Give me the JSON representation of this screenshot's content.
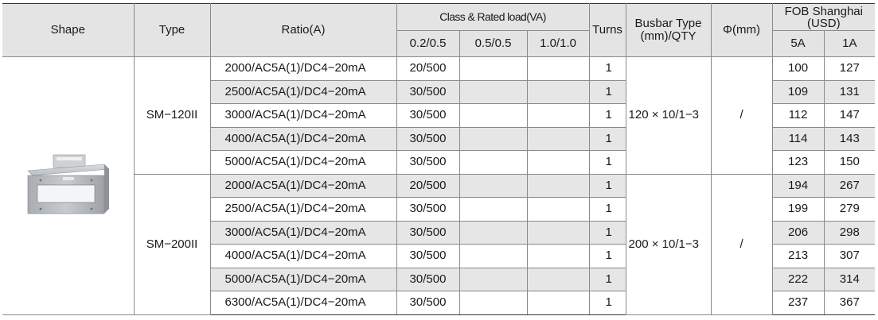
{
  "header": {
    "shape": "Shape",
    "type": "Type",
    "ratio": "Ratio(A)",
    "class_rated_load": "Class & Rated load(VA)",
    "class_02_05": "0.2/0.5",
    "class_05_05": "0.5/0.5",
    "class_10_10": "1.0/1.0",
    "turns": "Turns",
    "busbar": "Busbar Type (mm)/QTY",
    "phi": "Φ(mm)",
    "fob": "FOB Shanghai (USD)",
    "price_5a": "5A",
    "price_1a": "1A"
  },
  "groups": [
    {
      "type": "SM−120II",
      "busbar": "120 × 10/1−3",
      "phi": "/",
      "rows": [
        {
          "ratio": "2000/AC5A(1)/DC4−20mA",
          "c1": "20/500",
          "c2": "",
          "c3": "",
          "turns": "1",
          "p5a": "100",
          "p1a": "127"
        },
        {
          "ratio": "2500/AC5A(1)/DC4−20mA",
          "c1": "30/500",
          "c2": "",
          "c3": "",
          "turns": "1",
          "p5a": "109",
          "p1a": "131"
        },
        {
          "ratio": "3000/AC5A(1)/DC4−20mA",
          "c1": "30/500",
          "c2": "",
          "c3": "",
          "turns": "1",
          "p5a": "112",
          "p1a": "147"
        },
        {
          "ratio": "4000/AC5A(1)/DC4−20mA",
          "c1": "30/500",
          "c2": "",
          "c3": "",
          "turns": "1",
          "p5a": "114",
          "p1a": "143"
        },
        {
          "ratio": "5000/AC5A(1)/DC4−20mA",
          "c1": "30/500",
          "c2": "",
          "c3": "",
          "turns": "1",
          "p5a": "123",
          "p1a": "150"
        }
      ]
    },
    {
      "type": "SM−200II",
      "busbar": "200 × 10/1−3",
      "phi": "/",
      "rows": [
        {
          "ratio": "2000/AC5A(1)/DC4−20mA",
          "c1": "20/500",
          "c2": "",
          "c3": "",
          "turns": "1",
          "p5a": "194",
          "p1a": "267"
        },
        {
          "ratio": "2500/AC5A(1)/DC4−20mA",
          "c1": "30/500",
          "c2": "",
          "c3": "",
          "turns": "1",
          "p5a": "199",
          "p1a": "279"
        },
        {
          "ratio": "3000/AC5A(1)/DC4−20mA",
          "c1": "30/500",
          "c2": "",
          "c3": "",
          "turns": "1",
          "p5a": "206",
          "p1a": "298"
        },
        {
          "ratio": "4000/AC5A(1)/DC4−20mA",
          "c1": "30/500",
          "c2": "",
          "c3": "",
          "turns": "1",
          "p5a": "213",
          "p1a": "307"
        },
        {
          "ratio": "5000/AC5A(1)/DC4−20mA",
          "c1": "30/500",
          "c2": "",
          "c3": "",
          "turns": "1",
          "p5a": "222",
          "p1a": "314"
        },
        {
          "ratio": "6300/AC5A(1)/DC4−20mA",
          "c1": "30/500",
          "c2": "",
          "c3": "",
          "turns": "1",
          "p5a": "237",
          "p1a": "367"
        }
      ]
    }
  ],
  "product_image_icon": "split-core-current-transformer-icon",
  "colors": {
    "header_bg": "#e4e4e4",
    "shade_bg": "#e6e6e6",
    "border": "#8a8a8a"
  }
}
